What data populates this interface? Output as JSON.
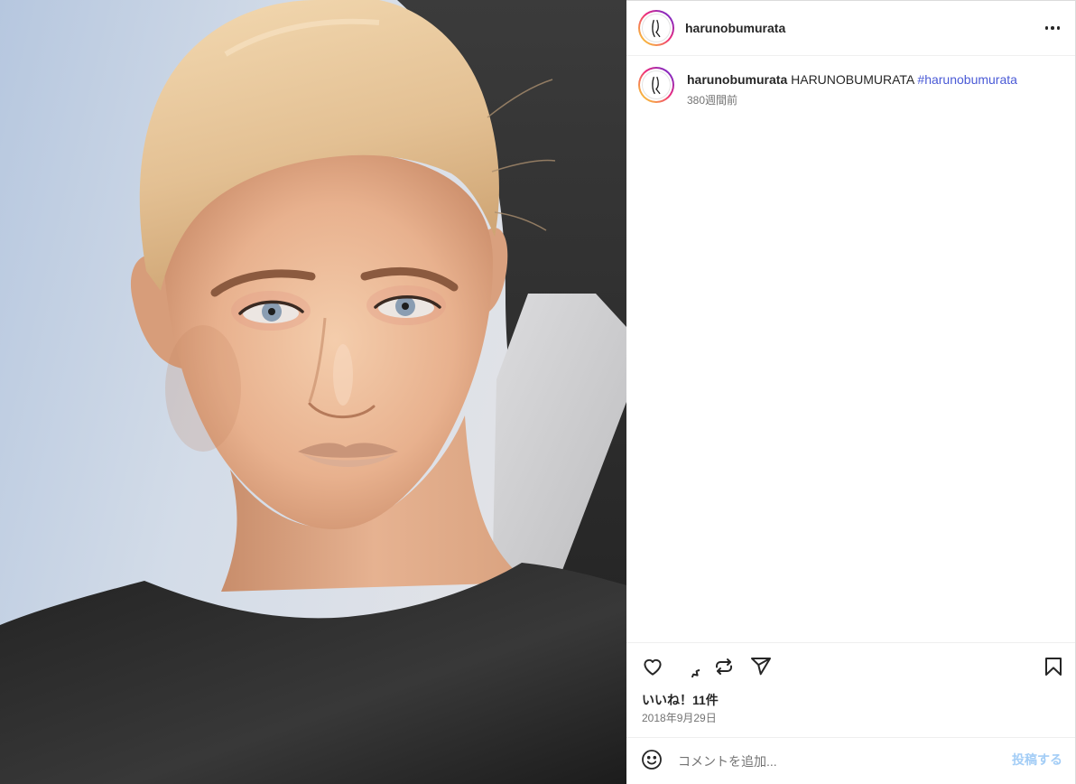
{
  "post": {
    "author": {
      "username": "harunobumurata"
    },
    "caption": {
      "username": "harunobumurata",
      "text": "HARUNOBUMURATA",
      "hashtag": "#harunobumurata",
      "time_ago": "380週間前"
    },
    "likes": "いいね！11件",
    "date": "2018年9月29日"
  },
  "comment": {
    "placeholder": "コメントを追加...",
    "submit_label": "投稿する"
  },
  "icons": {
    "avatar": "profile-avatar",
    "more": "more-options-icon",
    "like": "heart-icon",
    "comment": "comment-icon",
    "repost": "repost-icon",
    "share": "share-icon",
    "save": "bookmark-icon",
    "emoji": "emoji-icon"
  },
  "colors": {
    "text": "#262626",
    "secondary": "#737373",
    "hashtag": "#4a5ad6",
    "submit": "#a3cdf6",
    "divider": "#efefef",
    "ring_start": "#f9ce34",
    "ring_mid": "#ee2a7b",
    "ring_end": "#6228d7"
  }
}
